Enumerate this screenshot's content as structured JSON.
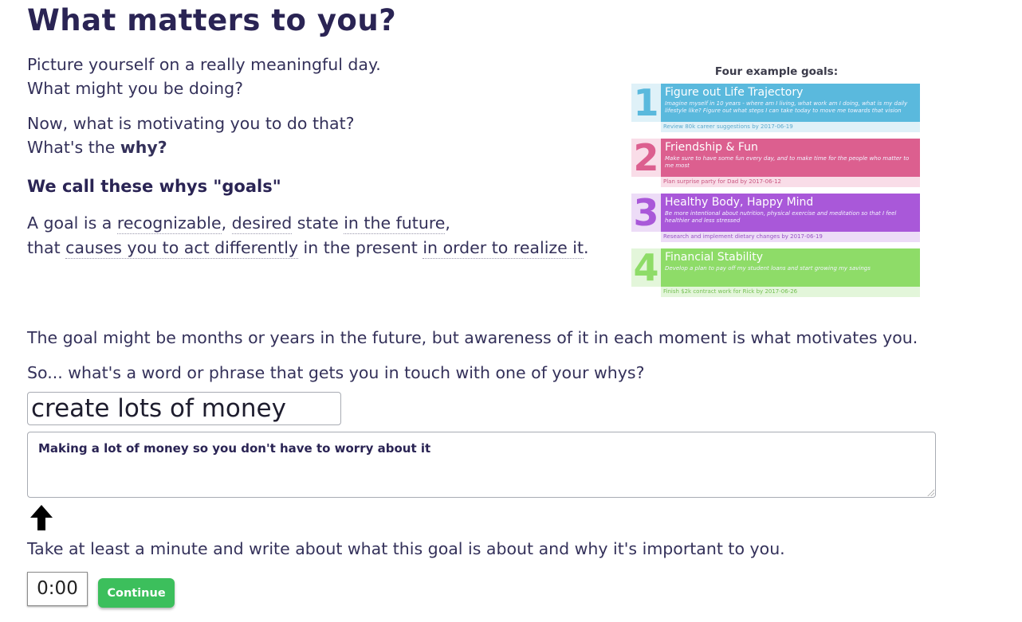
{
  "page": {
    "heading": "What matters to you?",
    "intro_line1": "Picture yourself on a really meaningful day.",
    "intro_line2": "What might you be doing?",
    "motivation_line1": "Now, what is motivating you to do that?",
    "motivation_prefix": "What's the ",
    "motivation_bold": "why?",
    "subheading": "We call these whys \"goals\"",
    "definition": {
      "p1": "A goal is a ",
      "recognizable": "recognizable",
      "comma1": ", ",
      "desired": "desired",
      "p2": " state ",
      "in_the_future": "in the future",
      "comma2": ",",
      "p3": "that ",
      "causes": "causes you to act differently",
      "p4": " in the present ",
      "in_order": "in order to realize it",
      "period": "."
    },
    "awareness_text": "The goal might be months or years in the future, but awareness of it in each moment is what motivates you.",
    "prompt_text": "So... what's a word or phrase that gets you in touch with one of your whys?",
    "instruction_text": "Take at least a minute and write about what this goal is about and why it's important to you."
  },
  "examples": {
    "title": "Four example goals:",
    "goals": [
      {
        "number": "1",
        "title": "Figure out Life Trajectory",
        "description": "Imagine myself in 10 years - where am I living, what work am I doing, what is my daily lifestyle like? Figure out what steps I can take today to move me towards that vision",
        "subgoal": "Review 80k career suggestions",
        "by": "by",
        "date": "2017-06-19"
      },
      {
        "number": "2",
        "title": "Friendship & Fun",
        "description": "Make sure to have some fun every day, and to make time for the people who matter to me most",
        "subgoal": "Plan surprise party for Dad",
        "by": "by",
        "date": "2017-06-12"
      },
      {
        "number": "3",
        "title": "Healthy Body, Happy Mind",
        "description": "Be more intentional about nutrition, physical exercise and meditation so that I feel healthier and less stressed",
        "subgoal": "Research and implement dietary changes",
        "by": "by",
        "date": "2017-06-19"
      },
      {
        "number": "4",
        "title": "Financial Stability",
        "description": "Develop a plan to pay off my student loans and start growing my savings",
        "subgoal": "Finish $2k contract work for Rick",
        "by": "by",
        "date": "2017-06-26"
      }
    ]
  },
  "form": {
    "goal_value": "create lots of money",
    "description_value": "Making a lot of money so you don't have to worry about it",
    "timer": "0:00",
    "continue_label": "Continue"
  },
  "icons": {
    "arrow": "up-arrow-icon",
    "resize": "resize-grip-icon"
  }
}
